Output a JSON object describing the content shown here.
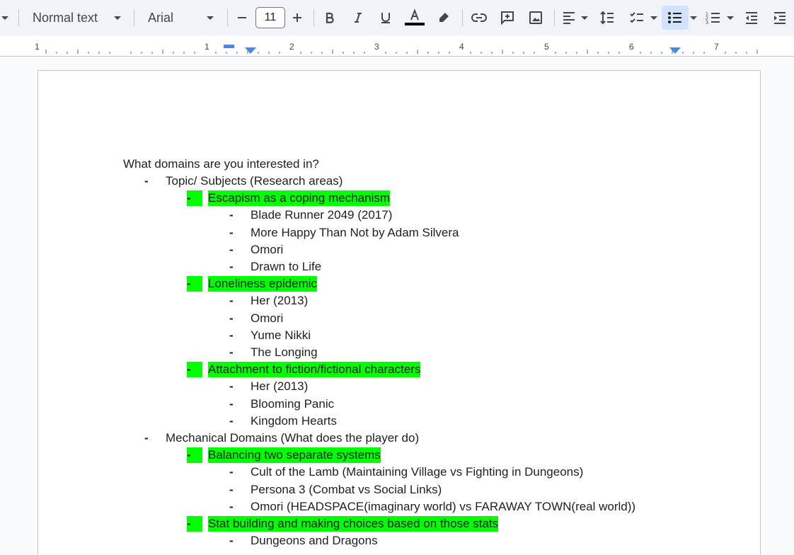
{
  "toolbar": {
    "style_label": "Normal text",
    "font_label": "Arial",
    "font_size": "11",
    "text_color": "#000000",
    "highlight_color": "#00ff00",
    "accent": "#d3e3fd"
  },
  "ruler": {
    "labels": [
      "1",
      "1",
      "2",
      "3",
      "4",
      "5",
      "6",
      "7"
    ]
  },
  "document": {
    "heading": "What domains are you interested in?",
    "bullet_char": "-",
    "lines": [
      {
        "level": 1,
        "text": "Topic/ Subjects (Research areas)",
        "highlight": false
      },
      {
        "level": 2,
        "text": "Escapism as a coping mechanism",
        "highlight": true
      },
      {
        "level": 3,
        "text": "Blade Runner 2049 (2017)",
        "highlight": false
      },
      {
        "level": 3,
        "text": "More Happy Than Not by Adam Silvera",
        "highlight": false
      },
      {
        "level": 3,
        "text": "Omori",
        "highlight": false
      },
      {
        "level": 3,
        "text": "Drawn to Life",
        "highlight": false
      },
      {
        "level": 2,
        "text": "Loneliness epidemic",
        "highlight": true
      },
      {
        "level": 3,
        "text": "Her (2013)",
        "highlight": false
      },
      {
        "level": 3,
        "text": "Omori",
        "highlight": false
      },
      {
        "level": 3,
        "text": "Yume Nikki",
        "highlight": false
      },
      {
        "level": 3,
        "text": "The Longing",
        "highlight": false
      },
      {
        "level": 2,
        "text": "Attachment to fiction/fictional characters",
        "highlight": true
      },
      {
        "level": 3,
        "text": "Her (2013)",
        "highlight": false
      },
      {
        "level": 3,
        "text": "Blooming Panic",
        "highlight": false
      },
      {
        "level": 3,
        "text": "Kingdom Hearts",
        "highlight": false
      },
      {
        "level": 1,
        "text": "Mechanical Domains (What does the player do)",
        "highlight": false
      },
      {
        "level": 2,
        "text": "Balancing two separate systems",
        "highlight": true
      },
      {
        "level": 3,
        "text": "Cult of the Lamb (Maintaining Village vs Fighting in Dungeons)",
        "highlight": false
      },
      {
        "level": 3,
        "text": "Persona 3 (Combat vs Social Links)",
        "highlight": false
      },
      {
        "level": 3,
        "text": "Omori (HEADSPACE(imaginary world) vs FARAWAY TOWN(real world))",
        "highlight": false
      },
      {
        "level": 2,
        "text": "Stat building and making choices based on those stats",
        "highlight": true
      },
      {
        "level": 3,
        "text": "Dungeons and Dragons",
        "highlight": false
      }
    ]
  }
}
